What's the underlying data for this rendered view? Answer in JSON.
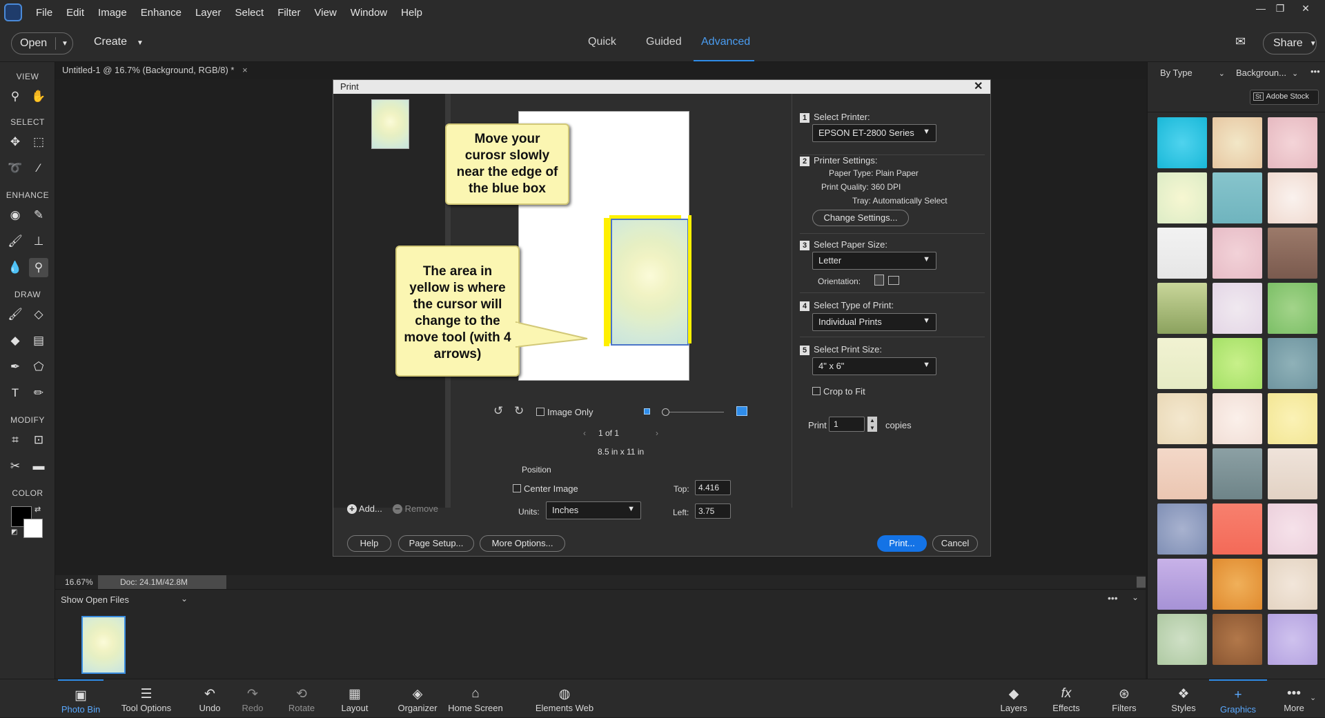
{
  "menubar": {
    "items": [
      "File",
      "Edit",
      "Image",
      "Enhance",
      "Layer",
      "Select",
      "Filter",
      "View",
      "Window",
      "Help"
    ]
  },
  "modebar": {
    "open": "Open",
    "create": "Create",
    "modes": [
      "Quick",
      "Guided",
      "Advanced"
    ],
    "active_mode": "Advanced",
    "share": "Share"
  },
  "toolbar": {
    "sections": [
      "VIEW",
      "SELECT",
      "ENHANCE",
      "DRAW",
      "MODIFY",
      "COLOR"
    ]
  },
  "document": {
    "tab": "Untitled-1 @ 16.7% (Background, RGB/8) *",
    "close": "×"
  },
  "statusbar": {
    "zoom": "16.67%",
    "doc": "Doc: 24.1M/42.8M"
  },
  "photobin": {
    "label": "Show Open Files"
  },
  "bottombar": {
    "items": [
      {
        "label": "Photo Bin",
        "icon": "photo-bin-icon"
      },
      {
        "label": "Tool Options",
        "icon": "tool-options-icon"
      },
      {
        "label": "Undo",
        "icon": "undo-icon"
      },
      {
        "label": "Redo",
        "icon": "redo-icon"
      },
      {
        "label": "Rotate",
        "icon": "rotate-icon"
      },
      {
        "label": "Layout",
        "icon": "layout-icon"
      },
      {
        "label": "Organizer",
        "icon": "organizer-icon"
      },
      {
        "label": "Home Screen",
        "icon": "home-icon"
      },
      {
        "label": "Elements Web",
        "icon": "globe-icon"
      },
      {
        "label": "Layers",
        "icon": "layers-icon"
      },
      {
        "label": "Effects",
        "icon": "effects-icon"
      },
      {
        "label": "Filters",
        "icon": "filters-icon"
      },
      {
        "label": "Styles",
        "icon": "styles-icon"
      },
      {
        "label": "Graphics",
        "icon": "graphics-icon"
      },
      {
        "label": "More",
        "icon": "more-icon"
      }
    ]
  },
  "rightpanel": {
    "filter": "By Type",
    "category": "Backgroun...",
    "stock": "Adobe Stock"
  },
  "dialog": {
    "title": "Print",
    "add": "Add...",
    "remove": "Remove",
    "image_only": "Image Only",
    "page": "1 of 1",
    "paper_dims": "8.5 in x 11 in",
    "position": "Position",
    "center_image": "Center Image",
    "units_label": "Units:",
    "units": "Inches",
    "top_label": "Top:",
    "top": "4.416",
    "left_label": "Left:",
    "left": "3.75",
    "callout1": "Move your curosr slowly near the edge of the blue box",
    "callout2": "The area in yellow is where the cursor will change to the move tool (with 4 arrows)",
    "s1_label": "Select Printer:",
    "printer": "EPSON ET-2800 Series",
    "s2_label": "Printer Settings:",
    "paper_type": "Paper Type: Plain Paper",
    "print_quality": "Print Quality: 360 DPI",
    "tray": "Tray: Automatically Select",
    "change_settings": "Change Settings...",
    "s3_label": "Select Paper Size:",
    "paper_size": "Letter",
    "orientation": "Orientation:",
    "s4_label": "Select Type of Print:",
    "print_type": "Individual Prints",
    "s5_label": "Select Print Size:",
    "print_size": "4\" x 6\"",
    "crop": "Crop to Fit",
    "print_label": "Print",
    "copies": "1",
    "copies_label": "copies",
    "help": "Help",
    "page_setup": "Page Setup...",
    "more_options": "More Options...",
    "print_btn": "Print...",
    "cancel": "Cancel",
    "steps": [
      "1",
      "2",
      "3",
      "4",
      "5"
    ]
  }
}
